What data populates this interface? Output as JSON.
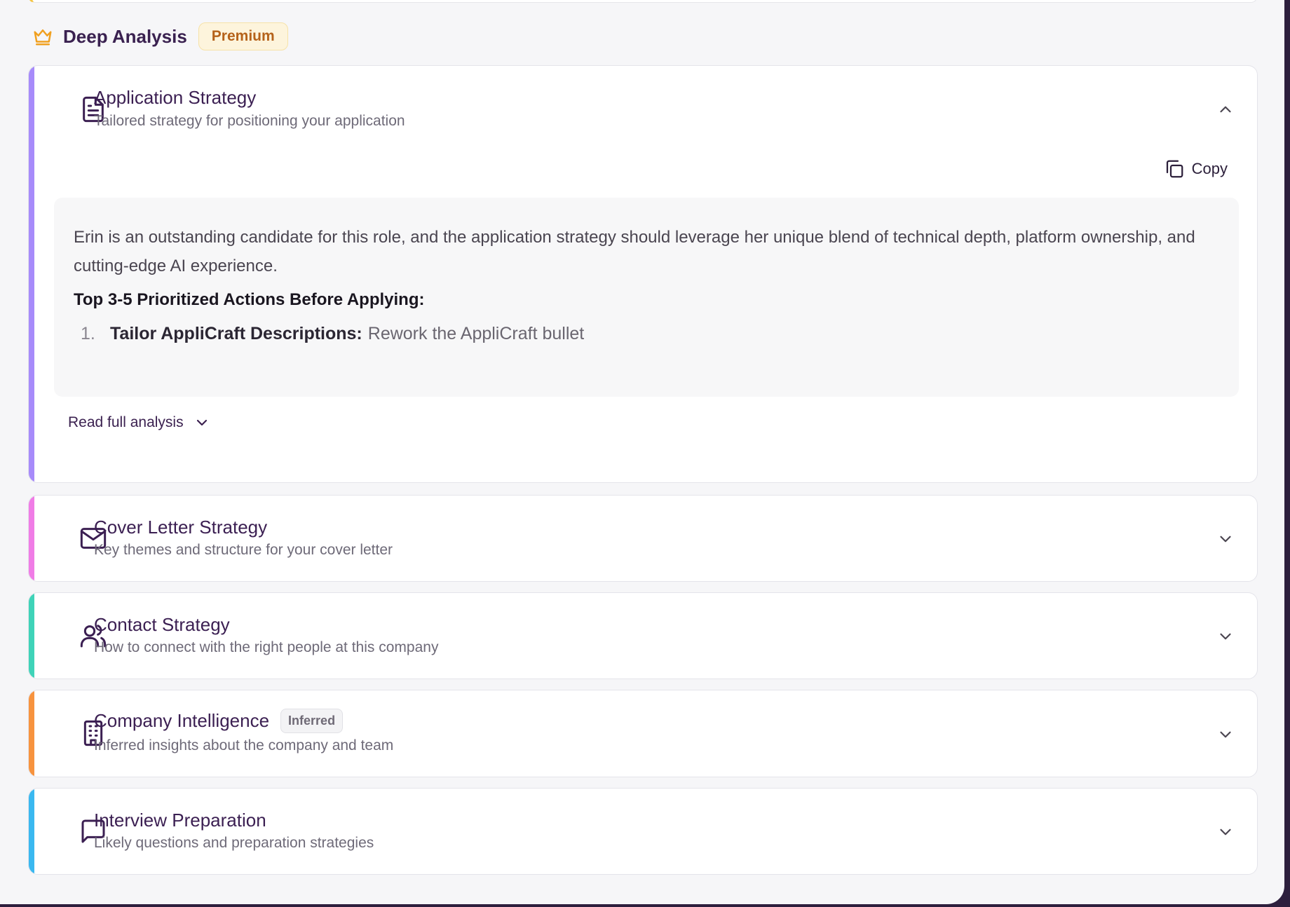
{
  "section": {
    "title": "Deep Analysis",
    "badge": "Premium"
  },
  "cards": [
    {
      "title": "Application Strategy",
      "subtitle": "Tailored strategy for positioning your application",
      "accent": "#a78bfa",
      "icon": "document-icon",
      "expanded": true,
      "copy_label": "Copy",
      "content": {
        "paragraph": "Erin is an outstanding candidate for this role, and the application strategy should leverage her unique blend of technical depth, platform ownership, and cutting-edge AI experience.",
        "heading": "Top 3-5 Prioritized Actions Before Applying:",
        "list": [
          {
            "number": "1.",
            "strong": "Tailor AppliCraft Descriptions:",
            "text": "Rework the AppliCraft bullet"
          }
        ]
      },
      "read_more_label": "Read full analysis"
    },
    {
      "title": "Cover Letter Strategy",
      "subtitle": "Key themes and structure for your cover letter",
      "accent": "#f07ce6",
      "icon": "mail-icon",
      "expanded": false
    },
    {
      "title": "Contact Strategy",
      "subtitle": "How to connect with the right people at this company",
      "accent": "#3fd3b8",
      "icon": "users-icon",
      "expanded": false
    },
    {
      "title": "Company Intelligence",
      "badge": "Inferred",
      "subtitle": "Inferred insights about the company and team",
      "accent": "#f7933e",
      "icon": "building-icon",
      "expanded": false
    },
    {
      "title": "Interview Preparation",
      "subtitle": "Likely questions and preparation strategies",
      "accent": "#3ab8f0",
      "icon": "message-square-icon",
      "expanded": false
    }
  ]
}
